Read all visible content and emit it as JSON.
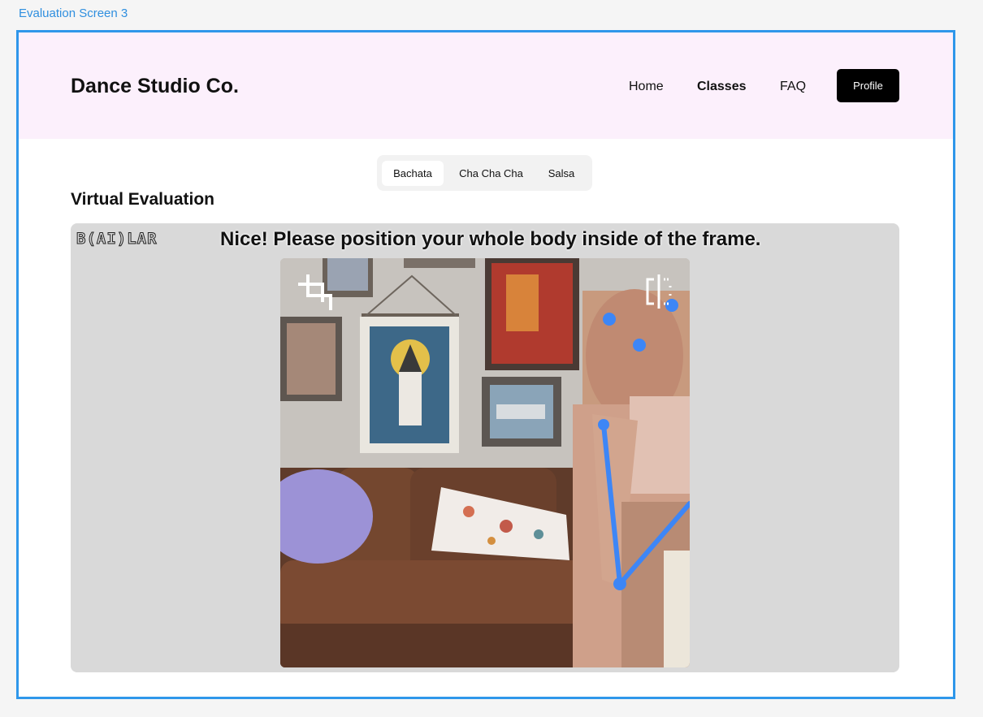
{
  "frame_label": "Evaluation Screen 3",
  "header": {
    "brand": "Dance Studio Co.",
    "nav": {
      "home": "Home",
      "classes": "Classes",
      "faq": "FAQ"
    },
    "profile_label": "Profile"
  },
  "tabs": [
    {
      "label": "Bachata",
      "active": true
    },
    {
      "label": "Cha Cha Cha",
      "active": false
    },
    {
      "label": "Salsa",
      "active": false
    }
  ],
  "section_title": "Virtual Evaluation",
  "evaluation": {
    "logo_text": "B(AI)LAR",
    "instruction": "Nice! Please position your whole body inside of the frame.",
    "icons": [
      "crop-icon",
      "mirror-flip-icon"
    ],
    "pose_color": "#3d86f6"
  },
  "colors": {
    "header_bg": "#fcf0fc",
    "frame_border": "#2f97ea",
    "panel_bg": "#d9d9d9",
    "profile_bg": "#000000"
  }
}
